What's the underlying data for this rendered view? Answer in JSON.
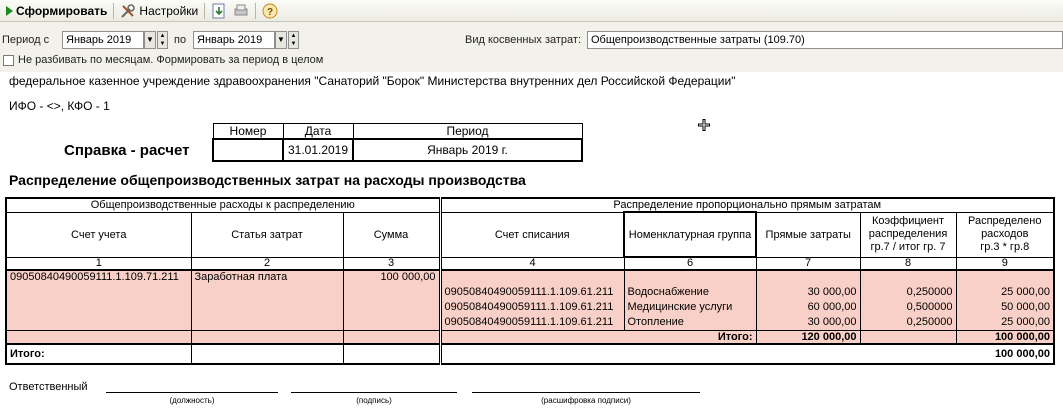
{
  "toolbar": {
    "generate_label": "Сформировать",
    "settings_label": "Настройки",
    "help_label": "?"
  },
  "params": {
    "period_from_label": "Период с",
    "period_from_value": "Январь 2019",
    "period_to_label": "по",
    "period_to_value": "Январь 2019",
    "cost_type_label": "Вид косвенных затрат:",
    "cost_type_value": "Общепроизводственные затраты (109.70)",
    "no_split_label": "Не разбивать по месяцам. Формировать за период в целом"
  },
  "report": {
    "org_name": "федеральное казенное учреждение здравоохранения \"Санаторий \"Борок\" Министерства внутренних дел Российской Федерации\"",
    "ifo_kfo": "ИФО - <>, КФО - 1",
    "doc_title": "Справка - расчет",
    "doc_header": {
      "number_label": "Номер",
      "date_label": "Дата",
      "period_label": "Период",
      "number": "",
      "date": "31.01.2019",
      "period": "Январь 2019 г."
    },
    "section_title": "Распределение общепроизводственных затрат на расходы производства",
    "group_left": "Общепроизводственные расходы к распределению",
    "group_right": "Распределение пропорционально прямым затратам",
    "columns": {
      "account": "Счет учета",
      "cost_item": "Статья затрат",
      "sum": "Сумма",
      "write_off": "Счет списания",
      "nomen_group": "Номенклатурная группа",
      "direct_costs": "Прямые затраты",
      "coef_l1": "Коэффициент",
      "coef_l2": "распределения",
      "coef_l3": "гр.7 / итог гр. 7",
      "distributed_l1": "Распределено",
      "distributed_l2": "расходов",
      "distributed_l3": "гр.3 * гр.8"
    },
    "col_numbers": [
      "1",
      "2",
      "3",
      "4",
      "6",
      "7",
      "8",
      "9"
    ],
    "left_row": {
      "account": "09050840490059111.1.109.71.211",
      "cost_item": "Заработная плата",
      "sum": "100 000,00"
    },
    "right_rows": [
      {
        "write_off": "09050840490059111.1.109.61.211",
        "group": "Водоснабжение",
        "direct": "30 000,00",
        "coef": "0,250000",
        "distributed": "25 000,00"
      },
      {
        "write_off": "09050840490059111.1.109.61.211",
        "group": "Медицинские услуги",
        "direct": "60 000,00",
        "coef": "0,500000",
        "distributed": "50 000,00"
      },
      {
        "write_off": "09050840490059111.1.109.61.211",
        "group": "Отопление",
        "direct": "30 000,00",
        "coef": "0,250000",
        "distributed": "25 000,00"
      }
    ],
    "subtotal_label": "Итого:",
    "subtotal_direct": "120 000,00",
    "subtotal_distributed": "100 000,00",
    "total_label": "Итого:",
    "total_distributed": "100 000,00",
    "responsible_label": "Ответственный",
    "sig_position": "(должность)",
    "sig_signature": "(подпись)",
    "sig_decoding": "(расшифровка подписи)"
  }
}
